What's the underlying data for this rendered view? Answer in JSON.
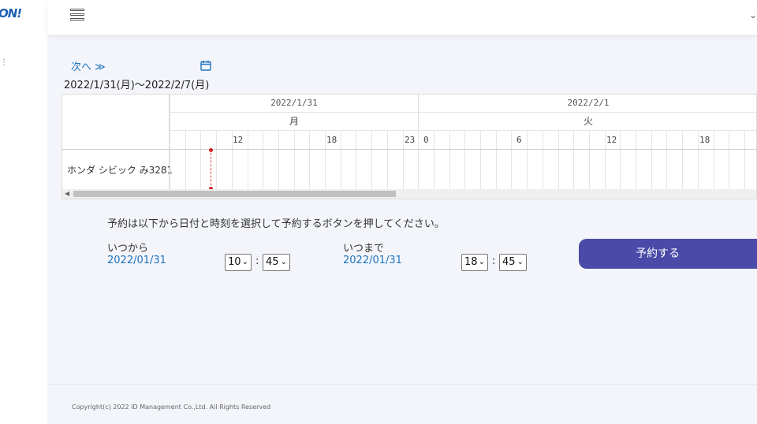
{
  "app": {
    "logo_text": "ON!",
    "side_mark": "⋮"
  },
  "header": {
    "menu_icon": "hamburger-icon",
    "right_mark": "⌄"
  },
  "navigation": {
    "next_label": "次へ ≫",
    "calendar_icon": "calendar-icon"
  },
  "range": {
    "text": "2022/1/31(月)〜2022/2/7(月)"
  },
  "timeline": {
    "days": [
      {
        "date": "2022/1/31",
        "weekday": "月"
      },
      {
        "date": "2022/2/1",
        "weekday": "火"
      }
    ],
    "hour_labels_day1": [
      "12",
      "18",
      "23"
    ],
    "hour_labels_day2": [
      "0",
      "6",
      "12",
      "18"
    ],
    "resource": "ホンダ シビック み3281"
  },
  "booking": {
    "instruction": "予約は以下から日付と時刻を選択して予約するボタンを押してください。",
    "from": {
      "label": "いつから",
      "date": "2022/01/31",
      "hour": "10",
      "minute": "45"
    },
    "to": {
      "label": "いつまで",
      "date": "2022/01/31",
      "hour": "18",
      "minute": "45"
    },
    "time_separator": ":",
    "submit_label": "予約する"
  },
  "footer": {
    "copyright": "Copyright(c) 2022 ID Management Co.,Ltd. All Rights Reserved"
  },
  "colors": {
    "accent": "#4a4aa8",
    "link": "#1e73be",
    "now_line": "#e23b3b"
  }
}
